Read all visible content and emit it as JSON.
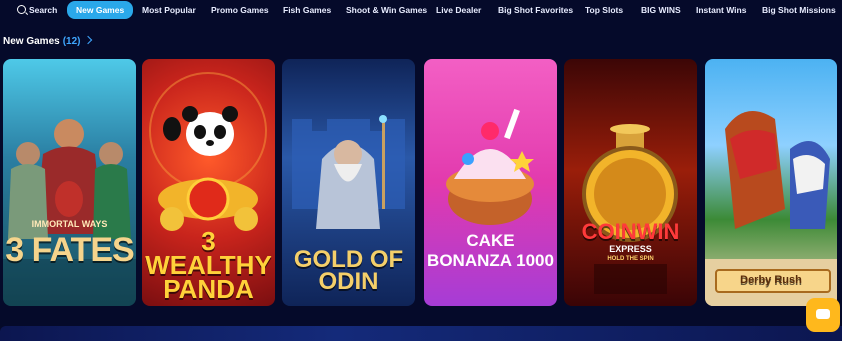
{
  "nav": {
    "items": [
      {
        "label": "Search"
      },
      {
        "label": "New Games"
      },
      {
        "label": "Most Popular"
      },
      {
        "label": "Promo Games"
      },
      {
        "label": "Fish Games"
      },
      {
        "label": "Shoot & Win Games"
      },
      {
        "label": "Live Dealer"
      },
      {
        "label": "Big Shot Favorites"
      },
      {
        "label": "Top Slots"
      },
      {
        "label": "BIG WINS"
      },
      {
        "label": "Instant Wins"
      },
      {
        "label": "Big Shot Missions"
      }
    ],
    "active": "New Games",
    "accent_color": "#2aa8ea"
  },
  "section": {
    "title": "New Games",
    "count": "(12)"
  },
  "games": [
    {
      "name_top": "IMMORTAL WAYS",
      "name": "3 FATES"
    },
    {
      "name": "3 WEALTHY PANDA"
    },
    {
      "name": "GOLD OF ODIN"
    },
    {
      "name": "CAKE BONANZA 1000"
    },
    {
      "name": "COINWIN",
      "subtitle": "EXPRESS",
      "tagline": "HOLD THE SPIN"
    },
    {
      "name": "Derby Rush"
    }
  ],
  "chat": {
    "icon": "chat-icon",
    "color": "#ffb81c"
  }
}
